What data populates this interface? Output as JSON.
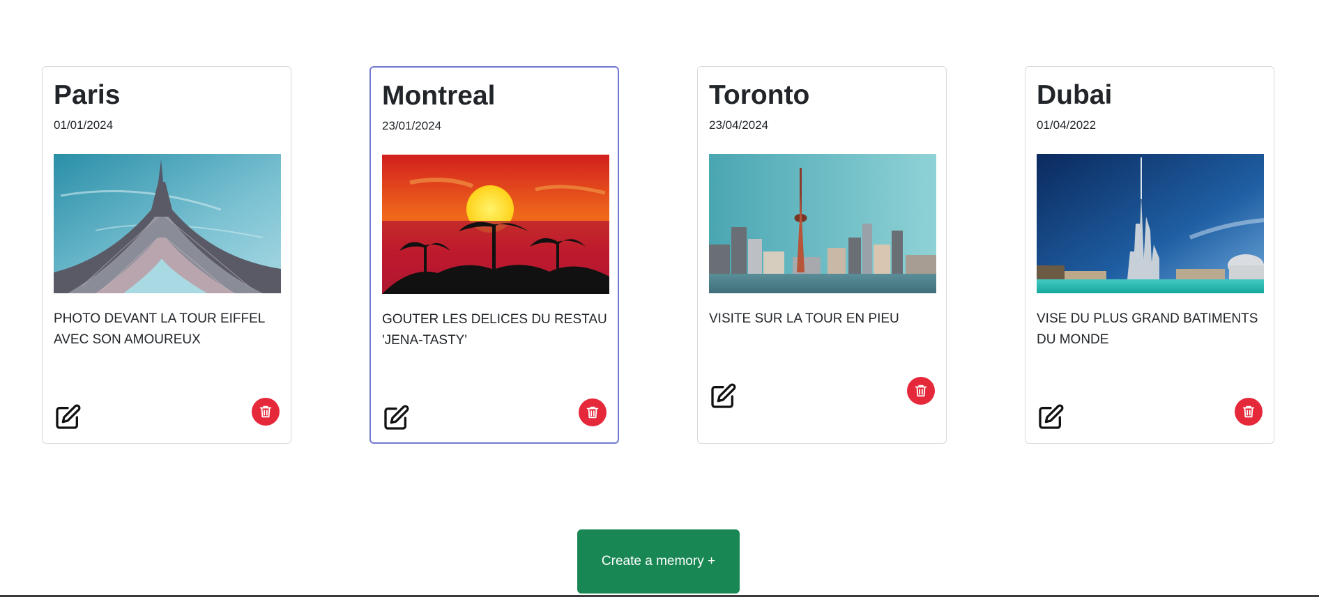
{
  "cards": [
    {
      "title": "Paris",
      "date": "01/01/2024",
      "description": "PHOTO DEVANT LA TOUR EIFFEL AVEC SON AMOUREUX",
      "image": "eiffel-tower-photo",
      "edit_icon": "edit-icon",
      "delete_icon": "trash-icon"
    },
    {
      "title": "Montreal",
      "date": "23/01/2024",
      "description": "GOUTER LES DELICES DU RESTAU 'JENA-TASTY'",
      "image": "tropical-sunset-photo",
      "edit_icon": "edit-icon",
      "delete_icon": "trash-icon"
    },
    {
      "title": "Toronto",
      "date": "23/04/2024",
      "description": "VISITE SUR LA TOUR EN PIEU",
      "image": "toronto-skyline-photo",
      "edit_icon": "edit-icon",
      "delete_icon": "trash-icon"
    },
    {
      "title": "Dubai",
      "date": "01/04/2022",
      "description": "VISE DU PLUS GRAND BATIMENTS DU MONDE",
      "image": "burj-khalifa-photo",
      "edit_icon": "edit-icon",
      "delete_icon": "trash-icon"
    }
  ],
  "create_button": {
    "label": "Create a memory +"
  },
  "colors": {
    "delete": "#e5293b",
    "create": "#198754",
    "active_border": "#6f79cf",
    "card_border": "#d9d9d9"
  }
}
